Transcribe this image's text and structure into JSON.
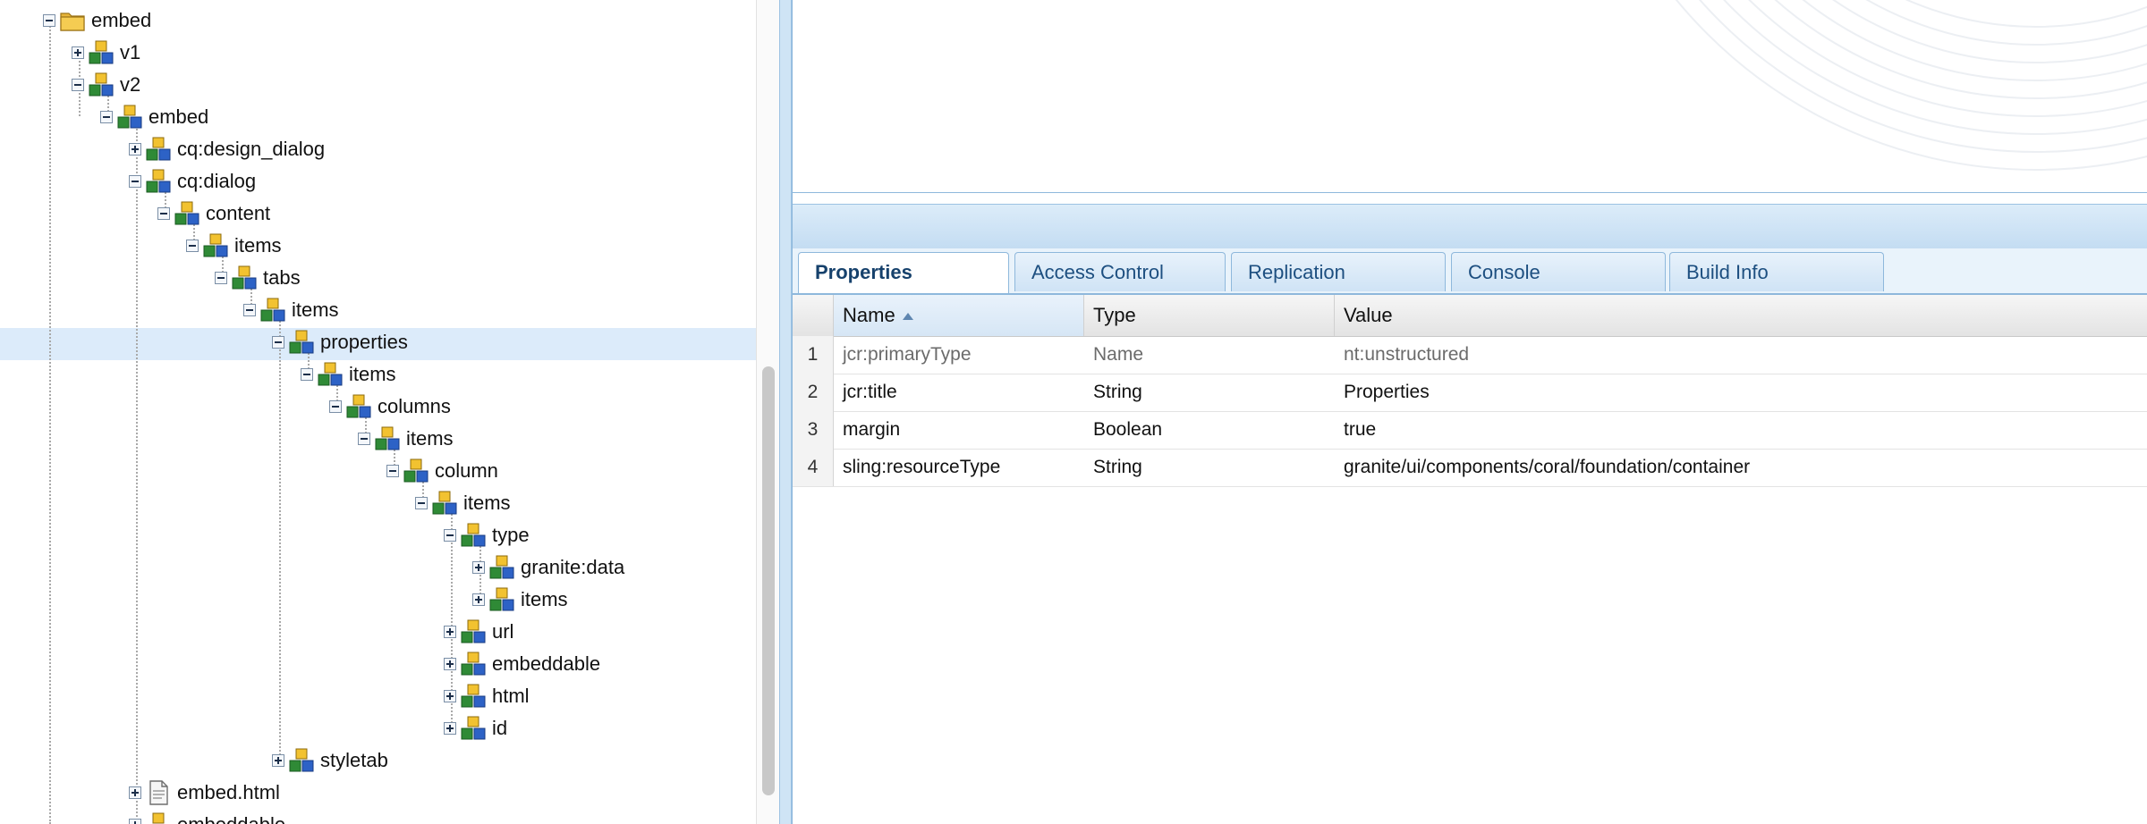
{
  "tree": {
    "nodes": [
      {
        "label": "embed",
        "icon": "folder-icon",
        "toggle": "minus"
      },
      {
        "label": "v1",
        "icon": "node-icon",
        "toggle": "plus"
      },
      {
        "label": "v2",
        "icon": "node-icon",
        "toggle": "minus"
      },
      {
        "label": "embed",
        "icon": "node-icon",
        "toggle": "minus"
      },
      {
        "label": "cq:design_dialog",
        "icon": "node-icon",
        "toggle": "plus"
      },
      {
        "label": "cq:dialog",
        "icon": "node-icon",
        "toggle": "minus"
      },
      {
        "label": "content",
        "icon": "node-icon",
        "toggle": "minus"
      },
      {
        "label": "items",
        "icon": "node-icon",
        "toggle": "minus"
      },
      {
        "label": "tabs",
        "icon": "node-icon",
        "toggle": "minus"
      },
      {
        "label": "items",
        "icon": "node-icon",
        "toggle": "minus"
      },
      {
        "label": "properties",
        "icon": "node-icon",
        "toggle": "minus",
        "selected": true
      },
      {
        "label": "items",
        "icon": "node-icon",
        "toggle": "minus"
      },
      {
        "label": "columns",
        "icon": "node-icon",
        "toggle": "minus"
      },
      {
        "label": "items",
        "icon": "node-icon",
        "toggle": "minus"
      },
      {
        "label": "column",
        "icon": "node-icon",
        "toggle": "minus"
      },
      {
        "label": "items",
        "icon": "node-icon",
        "toggle": "minus"
      },
      {
        "label": "type",
        "icon": "node-icon",
        "toggle": "minus"
      },
      {
        "label": "granite:data",
        "icon": "node-icon",
        "toggle": "plus"
      },
      {
        "label": "items",
        "icon": "node-icon",
        "toggle": "plus"
      },
      {
        "label": "url",
        "icon": "node-icon",
        "toggle": "plus"
      },
      {
        "label": "embeddable",
        "icon": "node-icon",
        "toggle": "plus"
      },
      {
        "label": "html",
        "icon": "node-icon",
        "toggle": "plus"
      },
      {
        "label": "id",
        "icon": "node-icon",
        "toggle": "plus"
      },
      {
        "label": "styletab",
        "icon": "node-icon",
        "toggle": "plus"
      },
      {
        "label": "embed.html",
        "icon": "file-icon",
        "toggle": "plus"
      },
      {
        "label": "embeddable",
        "icon": "node-icon",
        "toggle": "plus"
      }
    ]
  },
  "tabs": [
    "Properties",
    "Access Control",
    "Replication",
    "Console",
    "Build Info"
  ],
  "active_tab": "Properties",
  "grid": {
    "columns": [
      "Name",
      "Type",
      "Value"
    ],
    "sorted_column": "Name",
    "rows": [
      {
        "num": "1",
        "name": "jcr:primaryType",
        "type": "Name",
        "value": "nt:unstructured",
        "protected": true
      },
      {
        "num": "2",
        "name": "jcr:title",
        "type": "String",
        "value": "Properties"
      },
      {
        "num": "3",
        "name": "margin",
        "type": "Boolean",
        "value": "true"
      },
      {
        "num": "4",
        "name": "sling:resourceType",
        "type": "String",
        "value": "granite/ui/components/coral/foundation/container"
      }
    ]
  },
  "colors": {
    "accent": "#1d4f80",
    "selection": "#dcebfa",
    "panel_border": "#8eb8dc"
  }
}
